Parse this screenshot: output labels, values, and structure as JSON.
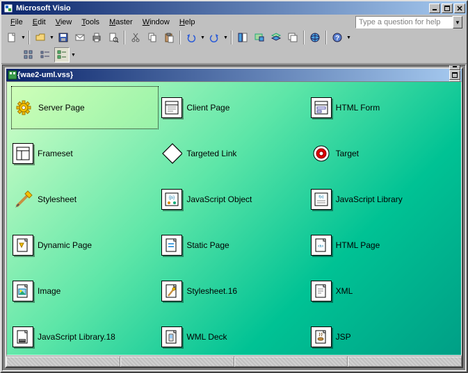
{
  "app": {
    "title": "Microsoft Visio"
  },
  "menu": {
    "items": [
      "File",
      "Edit",
      "View",
      "Tools",
      "Master",
      "Window",
      "Help"
    ]
  },
  "help_search": {
    "placeholder": "Type a question for help"
  },
  "child_window": {
    "title": "{wae2-uml.vss}"
  },
  "stencil": {
    "items": [
      {
        "id": "server-page",
        "label": "Server Page",
        "icon": "gear",
        "selected": true
      },
      {
        "id": "client-page",
        "label": "Client Page",
        "icon": "clientpage"
      },
      {
        "id": "html-form",
        "label": "HTML Form",
        "icon": "form"
      },
      {
        "id": "frameset",
        "label": "Frameset",
        "icon": "frameset"
      },
      {
        "id": "targeted-link",
        "label": "Targeted Link",
        "icon": "diamond"
      },
      {
        "id": "target",
        "label": "Target",
        "icon": "target"
      },
      {
        "id": "stylesheet",
        "label": "Stylesheet",
        "icon": "brush"
      },
      {
        "id": "javascript-object",
        "label": "JavaScript Object",
        "icon": "jsobj"
      },
      {
        "id": "javascript-library",
        "label": "JavaScript Library",
        "icon": "jslib"
      },
      {
        "id": "dynamic-page",
        "label": "Dynamic Page",
        "icon": "dynpage"
      },
      {
        "id": "static-page",
        "label": "Static Page",
        "icon": "staticpage"
      },
      {
        "id": "html-page",
        "label": "HTML Page",
        "icon": "htmlpage"
      },
      {
        "id": "image",
        "label": "Image",
        "icon": "image"
      },
      {
        "id": "stylesheet-16",
        "label": "Stylesheet.16",
        "icon": "stylesheet16"
      },
      {
        "id": "xml",
        "label": "XML",
        "icon": "xml"
      },
      {
        "id": "javascript-library-18",
        "label": "JavaScript Library.18",
        "icon": "jslib18"
      },
      {
        "id": "wml-deck",
        "label": "WML Deck",
        "icon": "wml"
      },
      {
        "id": "jsp",
        "label": "JSP",
        "icon": "jsp"
      }
    ]
  },
  "window_controls": {
    "minimize": "_",
    "maximize": "□",
    "close": "✕"
  }
}
